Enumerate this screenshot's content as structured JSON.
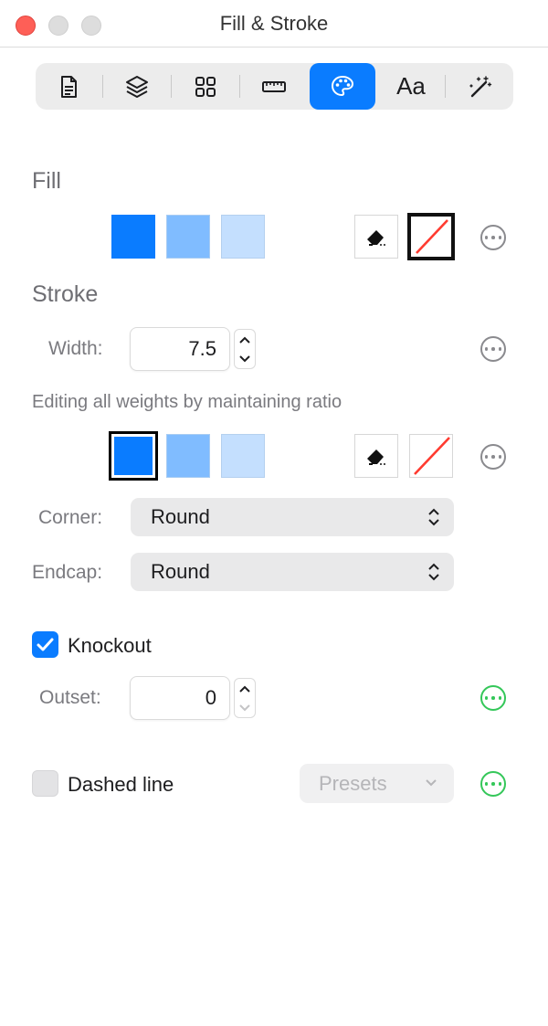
{
  "window": {
    "title": "Fill & Stroke"
  },
  "toolbar": {
    "items": [
      {
        "icon": "document-icon"
      },
      {
        "icon": "layers-icon"
      },
      {
        "icon": "grid-icon"
      },
      {
        "icon": "ruler-icon"
      },
      {
        "icon": "palette-icon",
        "selected": true
      },
      {
        "icon": "text-style-icon",
        "label": "Aa"
      },
      {
        "icon": "magic-wand-icon"
      }
    ]
  },
  "fill": {
    "heading": "Fill",
    "swatches": [
      "#0a7cff",
      "#80bcff",
      "#c4dffe"
    ],
    "selected_tool": "no-fill"
  },
  "stroke": {
    "heading": "Stroke",
    "width_label": "Width:",
    "width_value": "7.5",
    "ratio_note": "Editing all weights by maintaining ratio",
    "swatches": [
      "#0a7cff",
      "#80bcff",
      "#c4dffe"
    ],
    "selected_swatch": 0,
    "corner_label": "Corner:",
    "corner_value": "Round",
    "endcap_label": "Endcap:",
    "endcap_value": "Round"
  },
  "knockout": {
    "label": "Knockout",
    "checked": true,
    "outset_label": "Outset:",
    "outset_value": "0"
  },
  "dashed": {
    "label": "Dashed line",
    "checked": false,
    "presets_label": "Presets"
  },
  "colors": {
    "accent": "#0a7cff",
    "more_green": "#34c759",
    "no_color_line": "#ff3b30"
  }
}
